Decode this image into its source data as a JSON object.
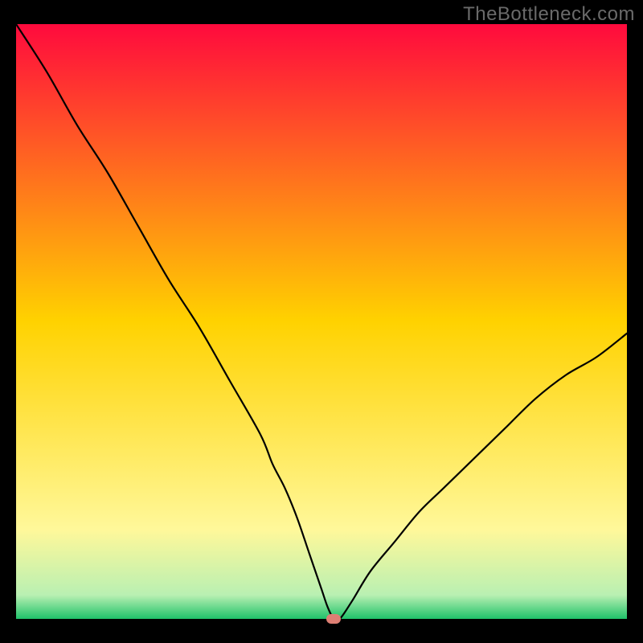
{
  "watermark": "TheBottleneck.com",
  "chart_data": {
    "type": "line",
    "title": "",
    "xlabel": "",
    "ylabel": "",
    "x": [
      0,
      5,
      10,
      15,
      20,
      25,
      30,
      35,
      40,
      42,
      44,
      46,
      48,
      50,
      51,
      52,
      53,
      55,
      58,
      62,
      66,
      70,
      75,
      80,
      85,
      90,
      95,
      100
    ],
    "values": [
      100,
      92,
      83,
      75,
      66,
      57,
      49,
      40,
      31,
      26,
      22,
      17,
      11,
      5,
      2,
      0,
      0,
      3,
      8,
      13,
      18,
      22,
      27,
      32,
      37,
      41,
      44,
      48
    ],
    "xlim": [
      0,
      100
    ],
    "ylim": [
      0,
      100
    ],
    "marker": {
      "x": 52,
      "y": 0
    },
    "background_gradient": {
      "stops": [
        {
          "offset": 0,
          "color": "#ff0a3d"
        },
        {
          "offset": 50,
          "color": "#ffd200"
        },
        {
          "offset": 85,
          "color": "#fff89a"
        },
        {
          "offset": 96,
          "color": "#b9f0b2"
        },
        {
          "offset": 100,
          "color": "#1fc26a"
        }
      ]
    }
  }
}
